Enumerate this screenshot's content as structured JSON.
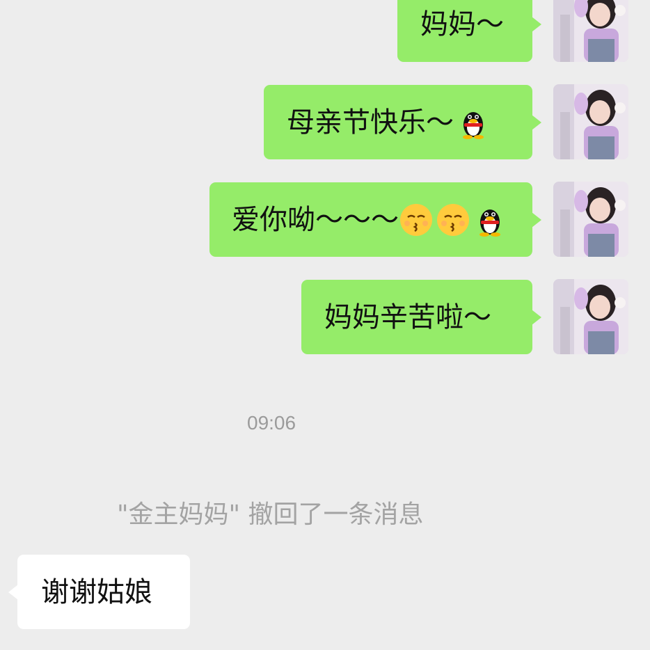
{
  "messages": [
    {
      "text": "妈妈～",
      "emojis": []
    },
    {
      "text": "母亲节快乐～",
      "emojis": [
        "qq-penguin-icon"
      ]
    },
    {
      "text": "爱你呦～～～",
      "emojis": [
        "kissing-face-icon",
        "kissing-face-icon",
        "qq-penguin-icon"
      ]
    },
    {
      "text": "妈妈辛苦啦～",
      "emojis": []
    }
  ],
  "timestamp": "09:06",
  "system_notice": "\"金主妈妈\" 撤回了一条消息",
  "reply": {
    "text": "谢谢姑娘"
  },
  "colors": {
    "background": "#ededed",
    "outgoing_bubble": "#95ec69",
    "incoming_bubble": "#ffffff",
    "meta_text": "#9b9b9b"
  }
}
